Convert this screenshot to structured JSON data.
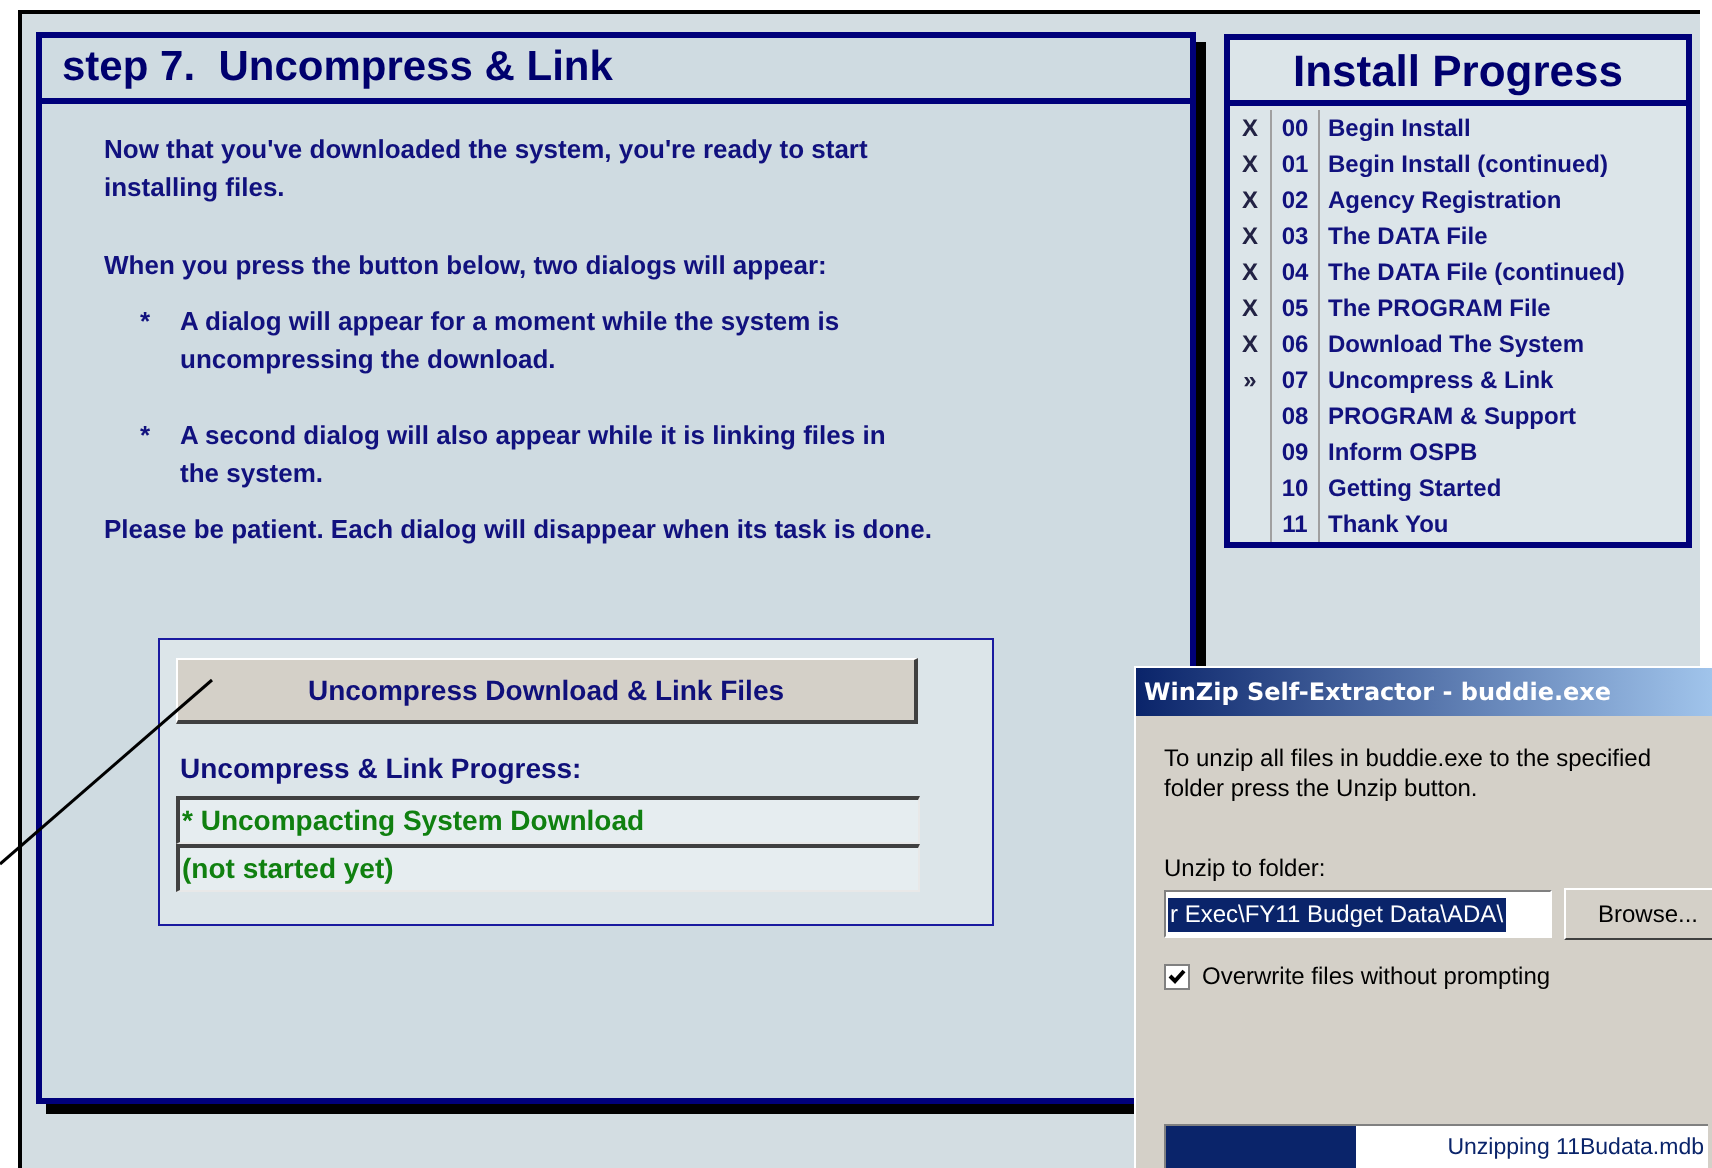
{
  "step_panel": {
    "title": "step 7.  Uncompress & Link",
    "paragraphs": [
      {
        "kind": "text",
        "text": "Now that you've downloaded the system, you're ready to start installing files."
      },
      {
        "kind": "text",
        "text": "When you press the button below, two dialogs will appear:"
      },
      {
        "kind": "bullet",
        "marker": "*",
        "text": "A dialog will appear for a moment while the system is uncompressing the download."
      },
      {
        "kind": "bullet",
        "marker": "*",
        "text": "A second dialog will also appear while it is linking files in the system."
      },
      {
        "kind": "text",
        "text": "Please be patient. Each dialog will disappear when its task is done."
      }
    ],
    "action_button": "Uncompress Download & Link Files",
    "progress_label": "Uncompress & Link Progress:",
    "progress_lines": [
      "* Uncompacting System Download",
      "(not started yet)"
    ]
  },
  "install_progress": {
    "title": "Install Progress",
    "steps": [
      {
        "marker": "X",
        "number": "00",
        "name": "Begin Install"
      },
      {
        "marker": "X",
        "number": "01",
        "name": "Begin Install (continued)"
      },
      {
        "marker": "X",
        "number": "02",
        "name": "Agency Registration"
      },
      {
        "marker": "X",
        "number": "03",
        "name": "The DATA File"
      },
      {
        "marker": "X",
        "number": "04",
        "name": "The DATA File (continued)"
      },
      {
        "marker": "X",
        "number": "05",
        "name": "The PROGRAM File"
      },
      {
        "marker": "X",
        "number": "06",
        "name": "Download The System"
      },
      {
        "marker": "»",
        "number": "07",
        "name": "Uncompress & Link"
      },
      {
        "number": "08",
        "name": "PROGRAM & Support"
      },
      {
        "number": "09",
        "name": "Inform OSPB"
      },
      {
        "number": "10",
        "name": "Getting Started"
      },
      {
        "number": "11",
        "name": "Thank You"
      }
    ]
  },
  "dialog": {
    "title": "WinZip Self-Extractor - buddie.exe",
    "message": "To unzip all files in buddie.exe to the specified folder press the Unzip button.",
    "folder_label": "Unzip to folder:",
    "folder_value": "r Exec\\FY11 Budget Data\\ADA\\",
    "browse_button": "Browse...",
    "overwrite": {
      "label": "Overwrite files without prompting",
      "checked": true
    },
    "progress": {
      "level": 0.35,
      "text": "Unzipping 11Budata.mdb"
    }
  }
}
